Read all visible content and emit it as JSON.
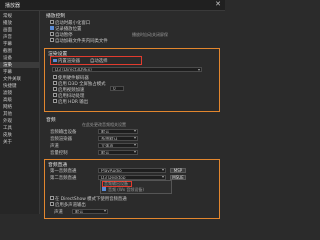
{
  "window": {
    "title": "播放器",
    "close_glyph": "✕"
  },
  "sidebar": {
    "items": [
      {
        "label": "常规"
      },
      {
        "label": "播放"
      },
      {
        "label": "画面"
      },
      {
        "label": "声音"
      },
      {
        "label": "字幕"
      },
      {
        "label": "截图"
      },
      {
        "label": "设备"
      },
      {
        "label": "渲染"
      },
      {
        "label": "字幕"
      },
      {
        "label": "文件关联"
      },
      {
        "label": "快捷键"
      },
      {
        "label": "滤镜"
      },
      {
        "label": "高级"
      },
      {
        "label": "网络"
      },
      {
        "label": "其他"
      },
      {
        "label": "外观"
      },
      {
        "label": "工具"
      },
      {
        "label": "皮肤"
      },
      {
        "label": "关于"
      }
    ],
    "selected_index": 7
  },
  "general": {
    "heading": "播放控制",
    "opt1": "启动时最小化窗口",
    "opt2": "记录播放位置",
    "opt3": "自动暂停",
    "opt3_extra": "播放时自动关闭屏保",
    "opt4": "自动加载文件夹内同类文件"
  },
  "render": {
    "heading": "渲染设置",
    "mode_value": "内置渲染器",
    "mode_option": "自动选择",
    "device_value": "D3 (Direct3D9Ex)",
    "opt_a": "使用硬件解码器",
    "opt_b": "启用 D3D 全屏独占模式",
    "spin_value": "0",
    "opt_c": "启用视频加速",
    "opt_d": "启用抖动处理",
    "opt_e": "启用 HDR 输出"
  },
  "sound": {
    "heading": "音频",
    "note": "在此处更改音频相关设置",
    "rows": [
      {
        "label": "音频输出设备",
        "value": "默认"
      },
      {
        "label": "音频渲染器",
        "value": "系统默认"
      },
      {
        "label": "声道",
        "value": "立体声"
      },
      {
        "label": "音量控制",
        "value": "默认"
      }
    ]
  },
  "passthrough": {
    "heading": "音频直通",
    "rows": [
      {
        "label": "第一音频直通",
        "value": "PlayAudio",
        "btn": "MSP"
      },
      {
        "label": "第二音频直通",
        "value": "D3 Desktop",
        "btn": "MSUE"
      }
    ],
    "menu_item_1": "音频输出设备",
    "menu_item_2": "音频 (Wx 音频设备)",
    "opt_f": "在 DirectShow 模式下使用音频直通",
    "opt_g": "启用多声道输出",
    "sub_label": "声道",
    "sub_value": "默认"
  }
}
